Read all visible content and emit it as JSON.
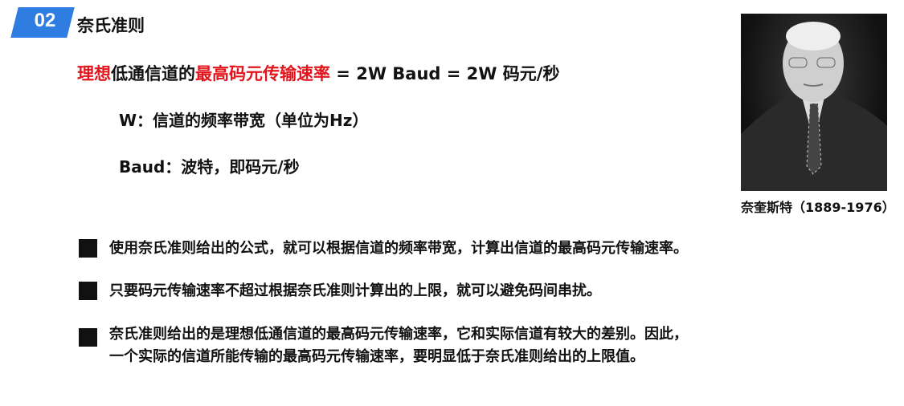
{
  "header": {
    "section_number": "02",
    "title": "奈氏准则"
  },
  "formula": {
    "part1": "理想",
    "part2": "低通信道的",
    "part3": "最高码元传输速率",
    "part4": " = 2W Baud = 2W 码元/秒"
  },
  "definitions": [
    "W：信道的频率带宽（单位为Hz）",
    "Baud：波特，即码元/秒"
  ],
  "portrait": {
    "caption": "奈奎斯特（1889-1976）"
  },
  "bullets": [
    [
      "使用奈氏准则给出的公式，就可以根据信道的频率带宽，计算出信道的最高码元传输速率。"
    ],
    [
      "只要码元传输速率不超过根据奈氏准则计算出的上限，就可以避免码间串扰。"
    ],
    [
      "奈氏准则给出的是理想低通信道的最高码元传输速率，它和实际信道有较大的差别。因此，",
      "一个实际的信道所能传输的最高码元传输速率，要明显低于奈氏准则给出的上限值。"
    ]
  ]
}
